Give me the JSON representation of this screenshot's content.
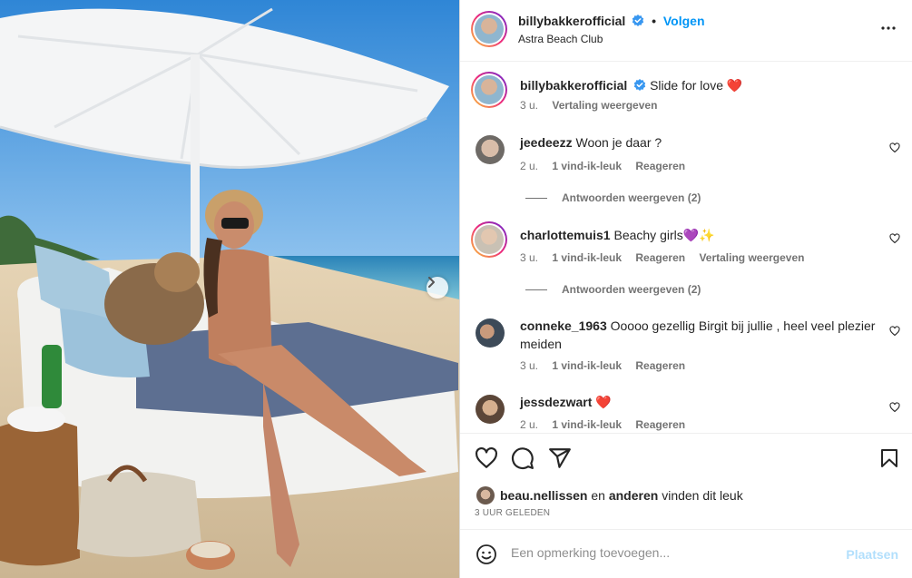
{
  "post": {
    "username": "billybakkerofficial",
    "follow_label": "Volgen",
    "location": "Astra Beach Club",
    "caption": "Slide for love ❤️",
    "caption_time": "3 u.",
    "translate_label": "Vertaling weergeven"
  },
  "comments": [
    {
      "username": "jeedeezz",
      "text": "Woon je daar ?",
      "time": "2 u.",
      "likes": "1 vind-ik-leuk",
      "reply": "Reageren",
      "view_replies": "Antwoorden weergeven (2)"
    },
    {
      "username": "charlottemuis1",
      "text": "Beachy girls💜✨",
      "time": "3 u.",
      "likes": "1 vind-ik-leuk",
      "reply": "Reageren",
      "translate": "Vertaling weergeven",
      "view_replies": "Antwoorden weergeven (2)"
    },
    {
      "username": "conneke_1963",
      "text": "Ooooo gezellig Birgit bij jullie , heel veel plezier meiden",
      "time": "3 u.",
      "likes": "1 vind-ik-leuk",
      "reply": "Reageren"
    },
    {
      "username": "jessdezwart",
      "text": "❤️",
      "time": "2 u.",
      "likes": "1 vind-ik-leuk",
      "reply": "Reageren"
    }
  ],
  "likes": {
    "liker": "beau.nellissen",
    "connector": "en",
    "others": "anderen",
    "suffix": "vinden dit leuk"
  },
  "timestamp": "3 UUR GELEDEN",
  "add_comment": {
    "placeholder": "Een opmerking toevoegen...",
    "post_label": "Plaatsen"
  },
  "icons": {
    "verified": "verified-badge-icon",
    "more": "more-options-icon",
    "like": "heart-icon",
    "comment": "comment-icon",
    "share": "share-icon",
    "save": "bookmark-icon",
    "emoji": "emoji-icon",
    "next": "chevron-right-icon"
  },
  "colors": {
    "accent": "#0095f6",
    "text": "#262626",
    "muted": "#737373"
  }
}
